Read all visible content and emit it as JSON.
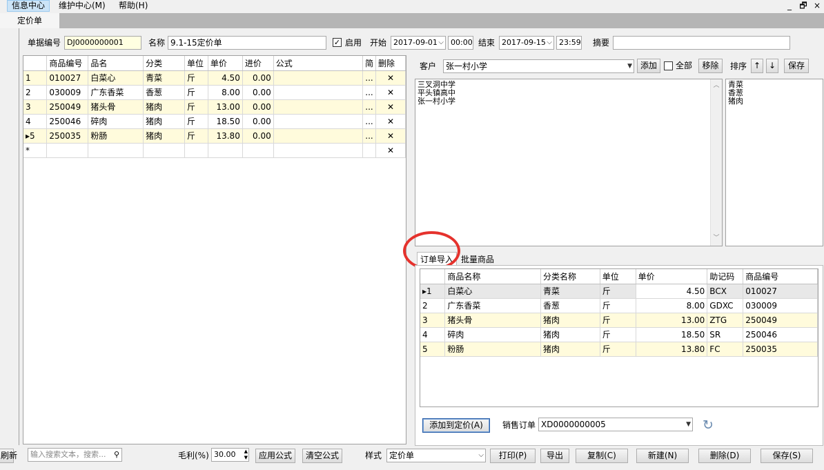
{
  "menu": {
    "items": [
      "信息中心",
      "维护中心(M)",
      "帮助(H)"
    ],
    "window_controls": [
      "_",
      "🗗",
      "×"
    ]
  },
  "tab": {
    "label": "定价单"
  },
  "header": {
    "doc_no_label": "单据编号",
    "doc_no_value": "DJ0000000001",
    "name_label": "名称",
    "name_value": "9.1-15定价单",
    "enabled_label": "启用",
    "enabled_checked": true,
    "start_label": "开始",
    "start_date": "2017-09-01",
    "start_time": "00:00",
    "end_label": "结束",
    "end_date": "2017-09-15",
    "end_time": "23:59",
    "memo_label": "摘要",
    "memo_value": ""
  },
  "price_grid": {
    "columns": [
      "商品编号",
      "品名",
      "分类",
      "单位",
      "单价",
      "进价",
      "公式",
      "简",
      "删除"
    ],
    "rows": [
      {
        "idx": "1",
        "code": "010027",
        "name": "白菜心",
        "cat": "青菜",
        "unit": "斤",
        "price": "4.50",
        "cost": "0.00",
        "formula": "",
        "dots": "...",
        "del": "✕"
      },
      {
        "idx": "2",
        "code": "030009",
        "name": "广东香菜",
        "cat": "香葱",
        "unit": "斤",
        "price": "8.00",
        "cost": "0.00",
        "formula": "",
        "dots": "...",
        "del": "✕"
      },
      {
        "idx": "3",
        "code": "250049",
        "name": "猪头骨",
        "cat": "猪肉",
        "unit": "斤",
        "price": "13.00",
        "cost": "0.00",
        "formula": "",
        "dots": "...",
        "del": "✕"
      },
      {
        "idx": "4",
        "code": "250046",
        "name": "碎肉",
        "cat": "猪肉",
        "unit": "斤",
        "price": "18.50",
        "cost": "0.00",
        "formula": "",
        "dots": "...",
        "del": "✕"
      },
      {
        "idx": "▸5",
        "code": "250035",
        "name": "粉肠",
        "cat": "猪肉",
        "unit": "斤",
        "price": "13.80",
        "cost": "0.00",
        "formula": "",
        "dots": "...",
        "del": "✕"
      }
    ],
    "new_row_marker": "*",
    "new_row_del": "✕"
  },
  "customer": {
    "label": "客户",
    "selected": "张一村小学",
    "add_label": "添加",
    "all_label": "全部",
    "remove_label": "移除",
    "sort_label": "排序",
    "up_label": "↑",
    "down_label": "↓",
    "save_label": "保存",
    "list": [
      "三叉洞中学",
      "平头镇高中",
      "张一村小学"
    ],
    "categories": [
      "青菜",
      "香葱",
      "猪肉"
    ]
  },
  "subtabs": [
    "订单导入",
    "批量商品"
  ],
  "import_grid": {
    "columns": [
      "商品名称",
      "分类名称",
      "单位",
      "单价",
      "助记码",
      "商品编号"
    ],
    "rows": [
      {
        "idx": "▸1",
        "name": "白菜心",
        "cat": "青菜",
        "unit": "斤",
        "price": "4.50",
        "mnemonic": "BCX",
        "code": "010027"
      },
      {
        "idx": "2",
        "name": "广东香菜",
        "cat": "香葱",
        "unit": "斤",
        "price": "8.00",
        "mnemonic": "GDXC",
        "code": "030009"
      },
      {
        "idx": "3",
        "name": "猪头骨",
        "cat": "猪肉",
        "unit": "斤",
        "price": "13.00",
        "mnemonic": "ZTG",
        "code": "250049"
      },
      {
        "idx": "4",
        "name": "碎肉",
        "cat": "猪肉",
        "unit": "斤",
        "price": "18.50",
        "mnemonic": "SR",
        "code": "250046"
      },
      {
        "idx": "5",
        "name": "粉肠",
        "cat": "猪肉",
        "unit": "斤",
        "price": "13.80",
        "mnemonic": "FC",
        "code": "250035"
      }
    ]
  },
  "import_footer": {
    "add_to_price_label": "添加到定价(A)",
    "sales_order_label": "销售订单",
    "sales_order_value": "XD0000000005",
    "refresh_icon": "↻"
  },
  "bottom": {
    "refresh_label": "刷新",
    "search_placeholder": "输入搜索文本，搜索...",
    "margin_label": "毛利(%)",
    "margin_value": "30.00",
    "apply_formula_label": "应用公式",
    "clear_formula_label": "清空公式",
    "style_label": "样式",
    "style_value": "定价单",
    "print_label": "打印(P)",
    "export_label": "导出",
    "copy_label": "复制(C)",
    "new_label": "新建(N)",
    "delete_label": "删除(D)",
    "save_label": "保存(S)"
  }
}
